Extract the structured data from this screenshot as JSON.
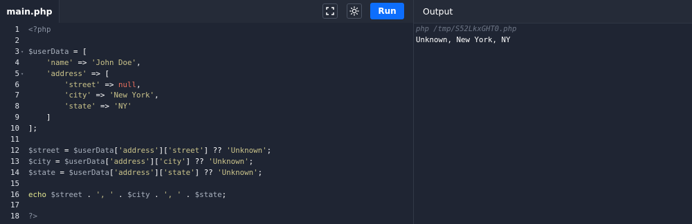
{
  "tabs": {
    "active_file": "main.php"
  },
  "toolbar": {
    "fullscreen_icon": "fullscreen-icon",
    "theme_icon": "sun-icon",
    "run_label": "Run",
    "run_color": "#0d6efd"
  },
  "editor": {
    "lines": [
      {
        "n": "1",
        "fold": "",
        "tokens": [
          [
            "tag",
            "<?php"
          ]
        ]
      },
      {
        "n": "2",
        "fold": "",
        "tokens": []
      },
      {
        "n": "3",
        "fold": "▾",
        "tokens": [
          [
            "var",
            "$userData"
          ],
          [
            "op",
            " = ["
          ]
        ]
      },
      {
        "n": "4",
        "fold": "",
        "tokens": [
          [
            "op",
            "    "
          ],
          [
            "str",
            "'name'"
          ],
          [
            "op",
            " => "
          ],
          [
            "str",
            "'John Doe'"
          ],
          [
            "op",
            ","
          ]
        ]
      },
      {
        "n": "5",
        "fold": "▾",
        "tokens": [
          [
            "op",
            "    "
          ],
          [
            "str",
            "'address'"
          ],
          [
            "op",
            " => ["
          ]
        ]
      },
      {
        "n": "6",
        "fold": "",
        "tokens": [
          [
            "op",
            "        "
          ],
          [
            "str",
            "'street'"
          ],
          [
            "op",
            " => "
          ],
          [
            "null",
            "null"
          ],
          [
            "op",
            ","
          ]
        ]
      },
      {
        "n": "7",
        "fold": "",
        "tokens": [
          [
            "op",
            "        "
          ],
          [
            "str",
            "'city'"
          ],
          [
            "op",
            " => "
          ],
          [
            "str",
            "'New York'"
          ],
          [
            "op",
            ","
          ]
        ]
      },
      {
        "n": "8",
        "fold": "",
        "tokens": [
          [
            "op",
            "        "
          ],
          [
            "str",
            "'state'"
          ],
          [
            "op",
            " => "
          ],
          [
            "str",
            "'NY'"
          ]
        ]
      },
      {
        "n": "9",
        "fold": "",
        "tokens": [
          [
            "op",
            "    ]"
          ]
        ]
      },
      {
        "n": "10",
        "fold": "",
        "tokens": [
          [
            "op",
            "];"
          ]
        ]
      },
      {
        "n": "11",
        "fold": "",
        "tokens": []
      },
      {
        "n": "12",
        "fold": "",
        "tokens": [
          [
            "var",
            "$street"
          ],
          [
            "op",
            " = "
          ],
          [
            "var",
            "$userData"
          ],
          [
            "op",
            "["
          ],
          [
            "str",
            "'address'"
          ],
          [
            "op",
            "]["
          ],
          [
            "str",
            "'street'"
          ],
          [
            "op",
            "] ?? "
          ],
          [
            "str",
            "'Unknown'"
          ],
          [
            "op",
            ";"
          ]
        ]
      },
      {
        "n": "13",
        "fold": "",
        "tokens": [
          [
            "var",
            "$city"
          ],
          [
            "op",
            " = "
          ],
          [
            "var",
            "$userData"
          ],
          [
            "op",
            "["
          ],
          [
            "str",
            "'address'"
          ],
          [
            "op",
            "]["
          ],
          [
            "str",
            "'city'"
          ],
          [
            "op",
            "] ?? "
          ],
          [
            "str",
            "'Unknown'"
          ],
          [
            "op",
            ";"
          ]
        ]
      },
      {
        "n": "14",
        "fold": "",
        "tokens": [
          [
            "var",
            "$state"
          ],
          [
            "op",
            " = "
          ],
          [
            "var",
            "$userData"
          ],
          [
            "op",
            "["
          ],
          [
            "str",
            "'address'"
          ],
          [
            "op",
            "]["
          ],
          [
            "str",
            "'state'"
          ],
          [
            "op",
            "] ?? "
          ],
          [
            "str",
            "'Unknown'"
          ],
          [
            "op",
            ";"
          ]
        ]
      },
      {
        "n": "15",
        "fold": "",
        "tokens": []
      },
      {
        "n": "16",
        "fold": "",
        "tokens": [
          [
            "kw",
            "echo"
          ],
          [
            "op",
            " "
          ],
          [
            "var",
            "$street"
          ],
          [
            "op",
            " . "
          ],
          [
            "str",
            "', '"
          ],
          [
            "op",
            " . "
          ],
          [
            "var",
            "$city"
          ],
          [
            "op",
            " . "
          ],
          [
            "str",
            "', '"
          ],
          [
            "op",
            " . "
          ],
          [
            "var",
            "$state"
          ],
          [
            "op",
            ";"
          ]
        ]
      },
      {
        "n": "17",
        "fold": "",
        "tokens": []
      },
      {
        "n": "18",
        "fold": "",
        "tokens": [
          [
            "tag",
            "?>"
          ]
        ]
      }
    ]
  },
  "output": {
    "title": "Output",
    "command": "php /tmp/S52LkxGHT0.php",
    "result": "Unknown, New York, NY"
  }
}
